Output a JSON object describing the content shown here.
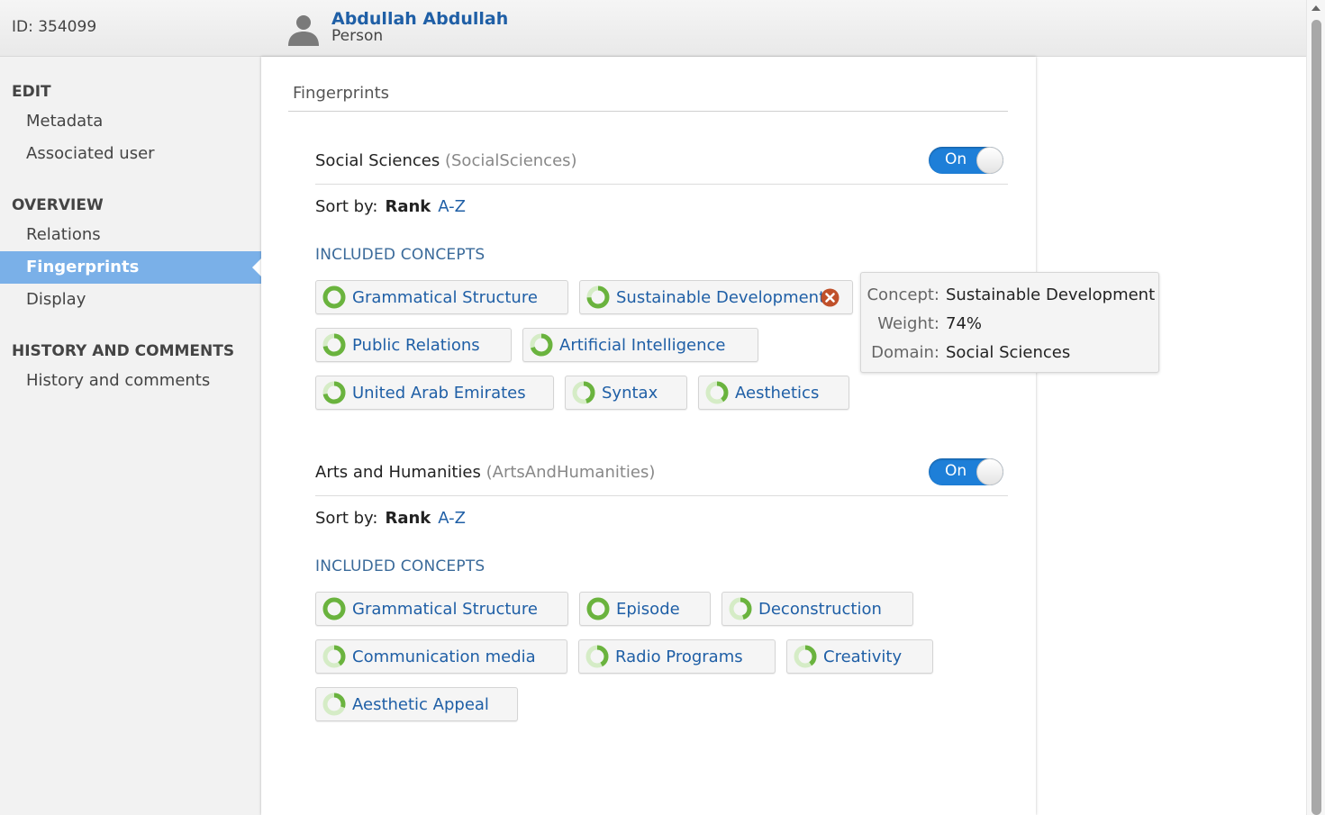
{
  "header": {
    "record_id": "ID: 354099",
    "person_name": "Abdullah Abdullah",
    "person_type": "Person"
  },
  "sidebar": {
    "edit_heading": "EDIT",
    "edit_items": [
      "Metadata",
      "Associated user"
    ],
    "overview_heading": "OVERVIEW",
    "overview_items": [
      "Relations",
      "Fingerprints",
      "Display"
    ],
    "active_item": "Fingerprints",
    "history_heading": "HISTORY AND COMMENTS",
    "history_items": [
      "History and comments"
    ]
  },
  "main": {
    "title": "Fingerprints",
    "domains": [
      {
        "name": "Social Sciences",
        "code": "(SocialSciences)",
        "toggle": "On",
        "sort_label": "Sort by:",
        "sort_rank": "Rank",
        "sort_az": "A-Z",
        "included_label": "INCLUDED CONCEPTS",
        "concepts": [
          {
            "label": "Grammatical Structure",
            "weight": 1.0
          },
          {
            "label": "Sustainable Development",
            "weight": 0.74,
            "removable": true
          },
          {
            "label": "Public Relations",
            "weight": 0.72
          },
          {
            "label": "Artificial Intelligence",
            "weight": 0.7
          },
          {
            "label": "United Arab Emirates",
            "weight": 0.72
          },
          {
            "label": "Syntax",
            "weight": 0.45
          },
          {
            "label": "Aesthetics",
            "weight": 0.4
          }
        ]
      },
      {
        "name": "Arts and Humanities",
        "code": "(ArtsAndHumanities)",
        "toggle": "On",
        "sort_label": "Sort by:",
        "sort_rank": "Rank",
        "sort_az": "A-Z",
        "included_label": "INCLUDED CONCEPTS",
        "concepts": [
          {
            "label": "Grammatical Structure",
            "weight": 1.0
          },
          {
            "label": "Episode",
            "weight": 1.0
          },
          {
            "label": "Deconstruction",
            "weight": 0.45
          },
          {
            "label": "Communication media",
            "weight": 0.4
          },
          {
            "label": "Radio Programs",
            "weight": 0.42
          },
          {
            "label": "Creativity",
            "weight": 0.4
          },
          {
            "label": "Aesthetic Appeal",
            "weight": 0.3
          }
        ]
      }
    ]
  },
  "tooltip": {
    "concept_key": "Concept:",
    "concept_val": "Sustainable Development",
    "weight_key": "Weight:",
    "weight_val": "74%",
    "domain_key": "Domain:",
    "domain_val": "Social Sciences"
  },
  "colors": {
    "accent": "#1f5fa6",
    "active_nav": "#7ab0e8",
    "toggle_on": "#1e7fd8",
    "ring_fill": "#6ab33e",
    "ring_track": "#d5ecc6",
    "remove": "#c0502a"
  }
}
